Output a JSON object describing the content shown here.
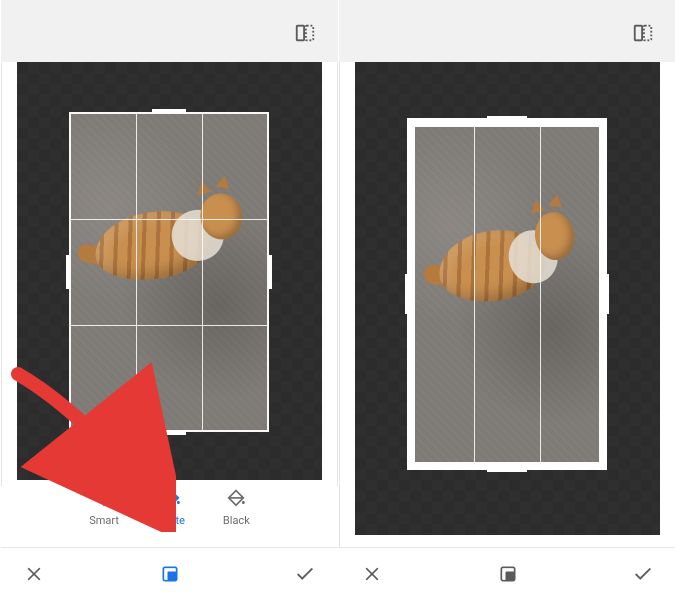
{
  "left": {
    "fill_options": [
      {
        "name": "smart",
        "label": "Smart",
        "active": false
      },
      {
        "name": "white",
        "label": "White",
        "active": true
      },
      {
        "name": "black",
        "label": "Black",
        "active": false
      }
    ],
    "selected_fill": "White",
    "bottom": {
      "cancel_icon": "close-icon",
      "center_icon": "format-crop-icon",
      "confirm_icon": "check-icon",
      "center_active": true
    },
    "topbar": {
      "flip_icon": "flip-icon"
    },
    "crop": {
      "frame_style": "thin"
    }
  },
  "right": {
    "bottom": {
      "cancel_icon": "close-icon",
      "center_icon": "format-crop-icon",
      "confirm_icon": "check-icon",
      "center_active": false
    },
    "topbar": {
      "flip_icon": "flip-icon"
    },
    "crop": {
      "frame_style": "thick-white"
    }
  },
  "annotation": {
    "arrow_target": "fill-option-white",
    "color": "#e53935"
  }
}
